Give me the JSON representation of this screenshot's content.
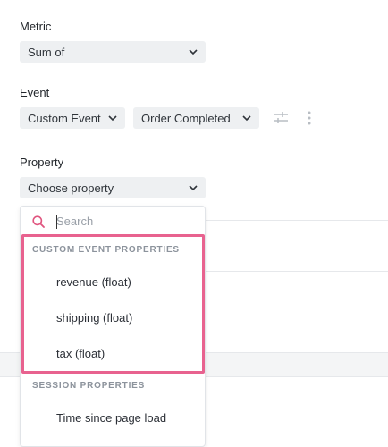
{
  "metric": {
    "label": "Metric",
    "value": "Sum of"
  },
  "event": {
    "label": "Event",
    "type_value": "Custom Event",
    "name_value": "Order Completed"
  },
  "property": {
    "label": "Property",
    "value": "Choose property",
    "search_placeholder": "Search",
    "sections": [
      {
        "title": "CUSTOM EVENT PROPERTIES",
        "options": [
          "revenue (float)",
          "shipping (float)",
          "tax (float)"
        ]
      },
      {
        "title": "SESSION PROPERTIES",
        "options": [
          "Time since page load"
        ]
      }
    ]
  },
  "colors": {
    "highlight": "#e8628f",
    "search_icon": "#e0557f",
    "select_bg": "#eef0f2"
  }
}
